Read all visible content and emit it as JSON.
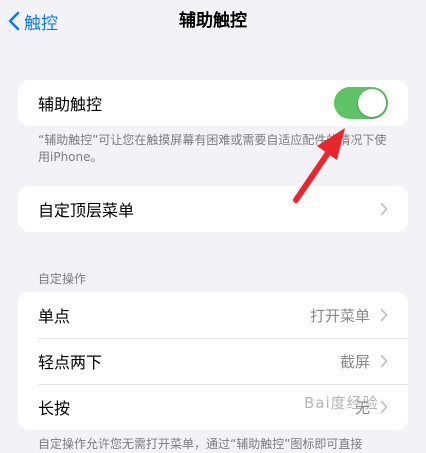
{
  "nav": {
    "back_label": "触控",
    "title": "辅助触控"
  },
  "assistive": {
    "label": "辅助触控",
    "toggle_on": true,
    "description": "“辅助触控”可让您在触摸屏幕有困难或需要自适应配件的情况下使用iPhone。"
  },
  "top_menu": {
    "label": "自定顶层菜单"
  },
  "custom_actions": {
    "header": "自定操作",
    "rows": [
      {
        "label": "单点",
        "value": "打开菜单"
      },
      {
        "label": "轻点两下",
        "value": "截屏"
      },
      {
        "label": "长按",
        "value": "无"
      }
    ],
    "footer": "自定操作允许您无需打开菜单，通过“辅助触控”图标即可直接"
  },
  "colors": {
    "accent": "#0a7aff",
    "toggle_on": "#5fc466",
    "annotation_arrow": "#e8262b"
  },
  "watermark": "Bai度经验"
}
